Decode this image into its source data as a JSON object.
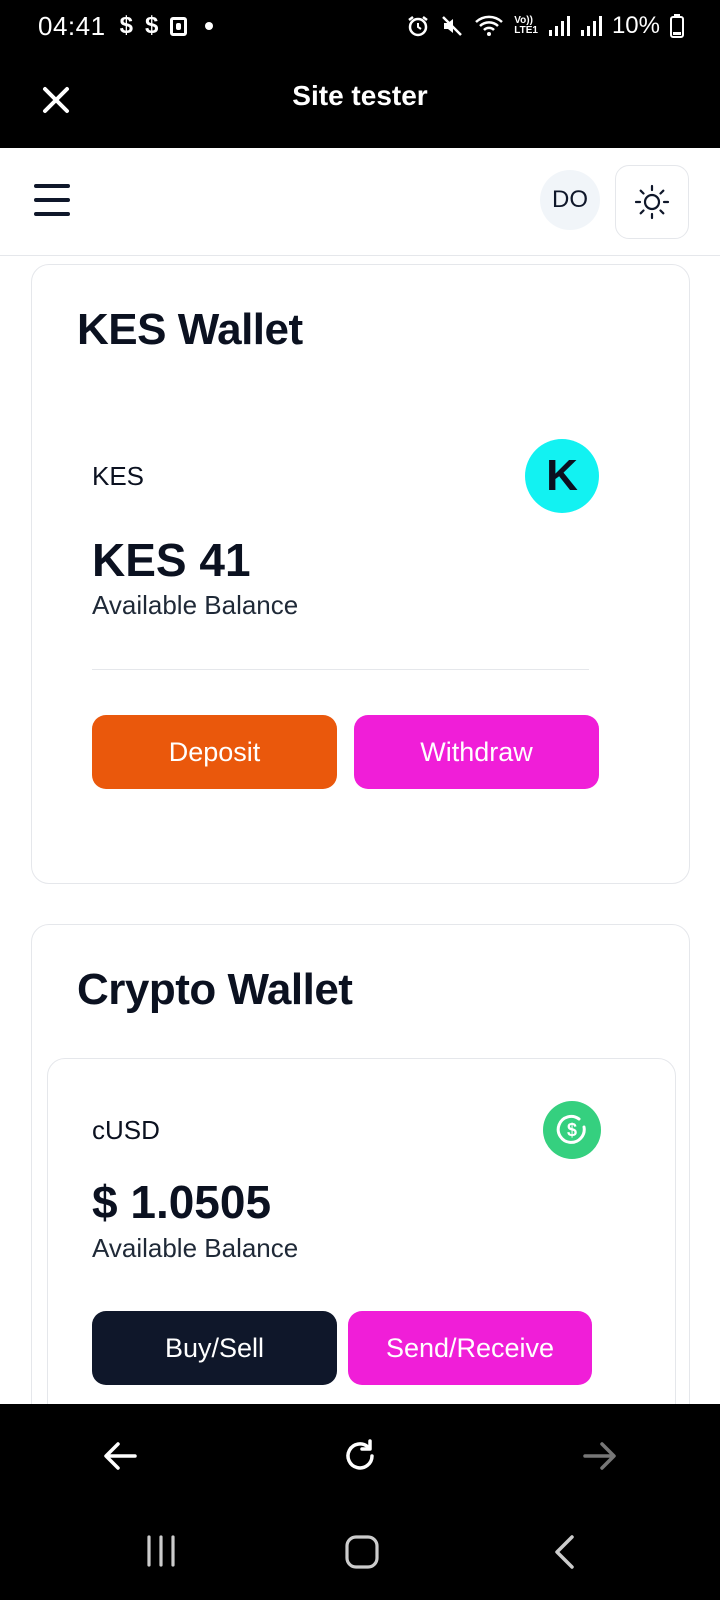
{
  "status_bar": {
    "time": "04:41",
    "left_icons": [
      "$",
      "$"
    ],
    "battery": "10%",
    "network_label_top": "Vo))",
    "network_label_bottom": "LTE1"
  },
  "browser": {
    "title": "Site tester"
  },
  "site_header": {
    "avatar_initials": "DO"
  },
  "kes_wallet": {
    "title": "KES Wallet",
    "currency": "KES",
    "logo_letter": "K",
    "balance": "KES 41",
    "balance_caption": "Available Balance",
    "deposit_label": "Deposit",
    "withdraw_label": "Withdraw"
  },
  "crypto_wallet": {
    "title": "Crypto Wallet",
    "currency": "cUSD",
    "balance": "$ 1.0505",
    "balance_caption": "Available Balance",
    "buy_sell_label": "Buy/Sell",
    "send_receive_label": "Send/Receive"
  },
  "colors": {
    "deposit": "#ea580c",
    "withdraw": "#f01ed8",
    "buy_sell": "#0f172a",
    "send_receive": "#f01ed8",
    "kes_logo": "#12f2f2",
    "cusd_logo": "#35d07f"
  },
  "icons": {
    "close": "close-icon",
    "menu": "menu-icon",
    "theme": "sun-icon",
    "back": "arrow-left-icon",
    "reload": "reload-icon",
    "forward": "arrow-right-icon"
  }
}
